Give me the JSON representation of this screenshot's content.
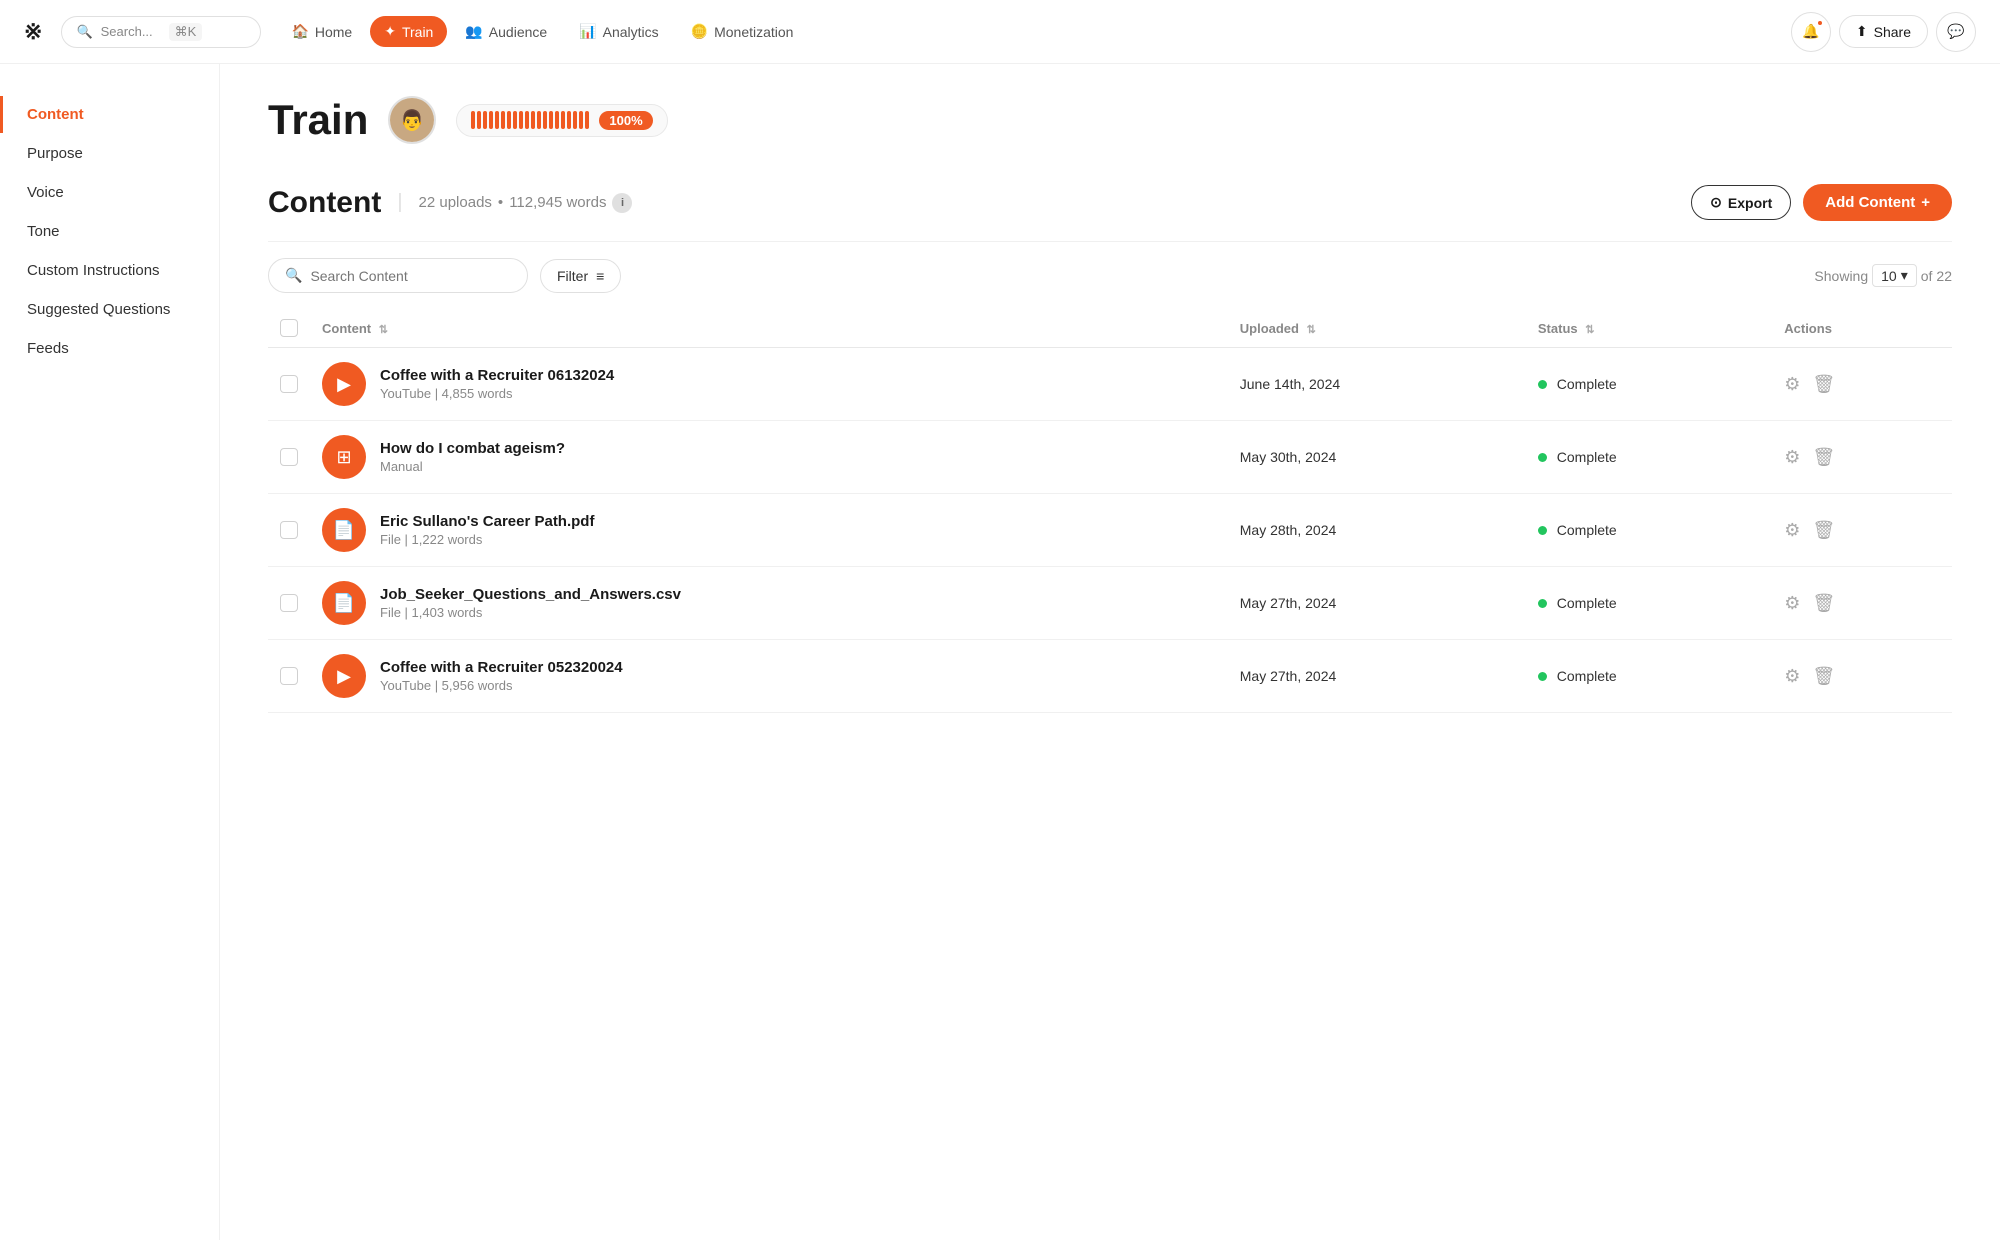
{
  "app": {
    "logo": "※",
    "title": "Train"
  },
  "topnav": {
    "search_placeholder": "Search...",
    "search_shortcut": "⌘K",
    "items": [
      {
        "id": "home",
        "label": "Home",
        "icon": "🏠",
        "active": false
      },
      {
        "id": "train",
        "label": "Train",
        "icon": "✦",
        "active": true
      },
      {
        "id": "audience",
        "label": "Audience",
        "icon": "👥",
        "active": false
      },
      {
        "id": "analytics",
        "label": "Analytics",
        "icon": "📊",
        "active": false
      },
      {
        "id": "monetization",
        "label": "Monetization",
        "icon": "🪙",
        "active": false
      }
    ],
    "share_label": "Share",
    "share_icon": "⬆"
  },
  "sidebar": {
    "items": [
      {
        "id": "content",
        "label": "Content",
        "active": true
      },
      {
        "id": "purpose",
        "label": "Purpose",
        "active": false
      },
      {
        "id": "voice",
        "label": "Voice",
        "active": false
      },
      {
        "id": "tone",
        "label": "Tone",
        "active": false
      },
      {
        "id": "custom-instructions",
        "label": "Custom Instructions",
        "active": false
      },
      {
        "id": "suggested-questions",
        "label": "Suggested Questions",
        "active": false
      },
      {
        "id": "feeds",
        "label": "Feeds",
        "active": false
      }
    ]
  },
  "page_header": {
    "title": "Train",
    "progress_label": "100%"
  },
  "content_section": {
    "title": "Content",
    "uploads_count": "22 uploads",
    "words_count": "112,945 words",
    "export_label": "Export",
    "add_content_label": "Add Content",
    "search_placeholder": "Search Content",
    "filter_label": "Filter",
    "showing_label": "Showing",
    "showing_count": "10",
    "total_count": "22",
    "columns": {
      "content": "Content",
      "uploaded": "Uploaded",
      "status": "Status",
      "actions": "Actions"
    },
    "rows": [
      {
        "id": 1,
        "icon_type": "youtube",
        "icon": "▶",
        "name": "Coffee with a Recruiter 06132024",
        "sub": "YouTube | 4,855 words",
        "uploaded": "June 14th, 2024",
        "status": "Complete"
      },
      {
        "id": 2,
        "icon_type": "manual",
        "icon": "⊞",
        "name": "How do I combat ageism?",
        "sub": "Manual",
        "uploaded": "May 30th, 2024",
        "status": "Complete"
      },
      {
        "id": 3,
        "icon_type": "file",
        "icon": "📄",
        "name": "Eric Sullano's Career Path.pdf",
        "sub": "File | 1,222 words",
        "uploaded": "May 28th, 2024",
        "status": "Complete"
      },
      {
        "id": 4,
        "icon_type": "file",
        "icon": "📄",
        "name": "Job_Seeker_Questions_and_Answers.csv",
        "sub": "File | 1,403 words",
        "uploaded": "May 27th, 2024",
        "status": "Complete"
      },
      {
        "id": 5,
        "icon_type": "youtube",
        "icon": "▶",
        "name": "Coffee with a Recruiter 052320024",
        "sub": "YouTube | 5,956 words",
        "uploaded": "May 27th, 2024",
        "status": "Complete"
      }
    ]
  }
}
